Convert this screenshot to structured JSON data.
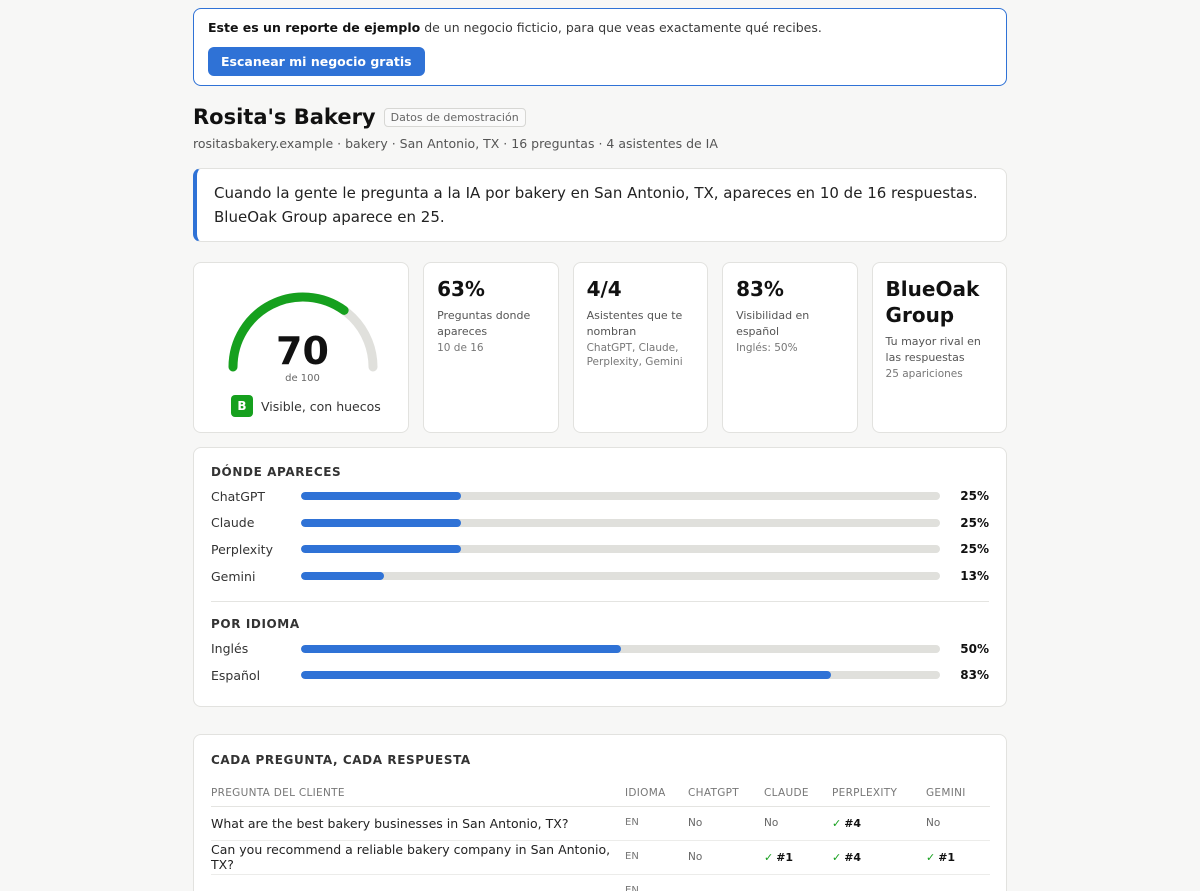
{
  "banner": {
    "bold": "Este es un reporte de ejemplo",
    "text": " de un negocio ficticio, para que veas exactamente qué recibes.",
    "cta": "Escanear mi negocio gratis"
  },
  "business": {
    "name": "Rosita's Bakery",
    "badge": "Datos de demostración",
    "subline": "rositasbakery.example · bakery · San Antonio, TX · 16 preguntas · 4 asistentes de IA"
  },
  "callout": "Cuando la gente le pregunta a la IA por bakery en San Antonio, TX, apareces en 10 de 16 respuestas. BlueOak Group aparece en 25.",
  "score": {
    "value": 70,
    "value_text": "70",
    "of": "de 100",
    "grade": "B",
    "grade_label": "Visible, con huecos",
    "colors": {
      "fill": "#16a01e",
      "track": "#e0e0dc"
    }
  },
  "stats": [
    {
      "value": "63%",
      "label": "Preguntas donde apareces",
      "sub": "10 de 16"
    },
    {
      "value": "4/4",
      "label": "Asistentes que te nombran",
      "sub": "ChatGPT, Claude, Perplexity, Gemini"
    },
    {
      "value": "83%",
      "label": "Visibilidad en español",
      "sub": "Inglés: 50%"
    },
    {
      "value": "BlueOak Group",
      "label": "Tu mayor rival en las respuestas",
      "sub": "25 apariciones"
    }
  ],
  "where": {
    "title": "DÓNDE APARECES",
    "rows": [
      {
        "label": "ChatGPT",
        "pct": 25,
        "pct_text": "25%"
      },
      {
        "label": "Claude",
        "pct": 25,
        "pct_text": "25%"
      },
      {
        "label": "Perplexity",
        "pct": 25,
        "pct_text": "25%"
      },
      {
        "label": "Gemini",
        "pct": 13,
        "pct_text": "13%"
      }
    ]
  },
  "language": {
    "title": "POR IDIOMA",
    "rows": [
      {
        "label": "Inglés",
        "pct": 50,
        "pct_text": "50%"
      },
      {
        "label": "Español",
        "pct": 83,
        "pct_text": "83%"
      }
    ]
  },
  "questions": {
    "title": "CADA PREGUNTA, CADA RESPUESTA",
    "headers": [
      "PREGUNTA DEL CLIENTE",
      "IDIOMA",
      "CHATGPT",
      "CLAUDE",
      "PERPLEXITY",
      "GEMINI"
    ],
    "rows": [
      {
        "question": "What are the best bakery businesses in San Antonio, TX?",
        "lang": "EN",
        "chatgpt": "No",
        "claude": "No",
        "perplexity": "#4",
        "gemini": "No"
      },
      {
        "question": "Can you recommend a reliable bakery company in San Antonio, TX?",
        "lang": "EN",
        "chatgpt": "No",
        "claude": "#1",
        "perplexity": "#4",
        "gemini": "#1"
      },
      {
        "question": "",
        "lang": "EN",
        "chatgpt": "",
        "claude": "",
        "perplexity": "",
        "gemini": ""
      }
    ]
  },
  "icons": {
    "check": "check-icon"
  },
  "colors": {
    "accent": "#2f72d6",
    "success": "#16a01e"
  }
}
